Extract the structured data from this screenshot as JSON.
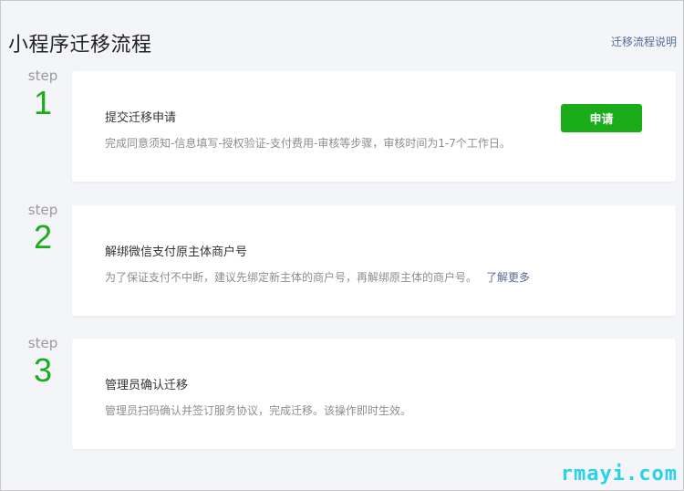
{
  "header": {
    "title": "小程序迁移流程",
    "help_link": "迁移流程说明"
  },
  "steps": [
    {
      "label": "step",
      "number": "1",
      "title": "提交迁移申请",
      "description": "完成同意须知-信息填写-授权验证-支付费用-审核等步骤，审核时间为1-7个工作日。",
      "button": "申请"
    },
    {
      "label": "step",
      "number": "2",
      "title": "解绑微信支付原主体商户号",
      "description": "为了保证支付不中断，建议先绑定新主体的商户号，再解绑原主体的商户号。",
      "link": "了解更多"
    },
    {
      "label": "step",
      "number": "3",
      "title": "管理员确认迁移",
      "description": "管理员扫码确认并签订服务协议，完成迁移。该操作即时生效。"
    }
  ],
  "watermark": "rmayi.com",
  "colors": {
    "accent": "#1aad19",
    "link": "#576b95",
    "background": "#f4f5f9"
  }
}
